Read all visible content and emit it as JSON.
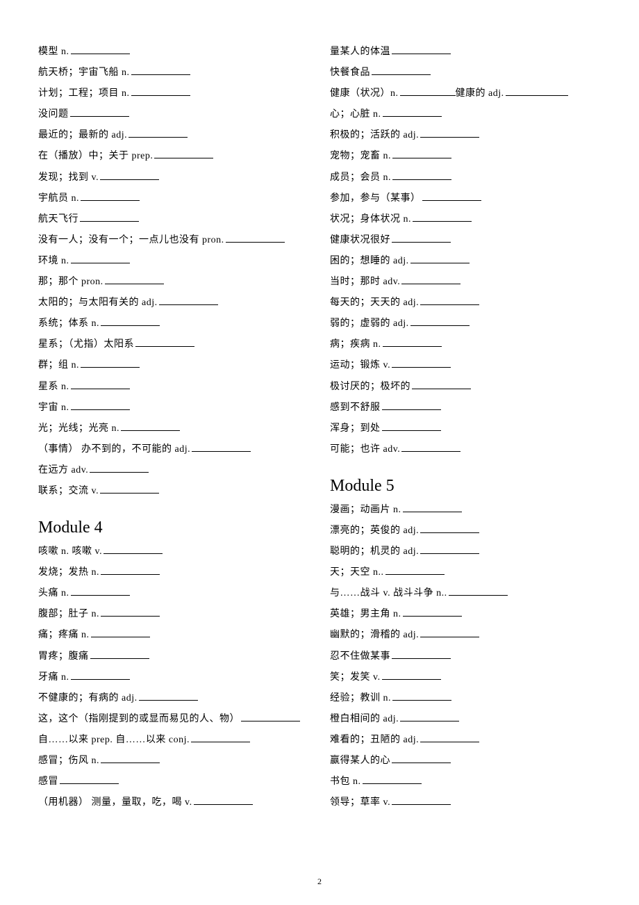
{
  "pageNumber": "2",
  "leftCol": {
    "section1": [
      "模型 n.",
      "航天桥；宇宙飞船 n.",
      "计划；工程；项目 n.",
      "没问题",
      "最近的；最新的 adj.",
      "在（播放）中；关于 prep.",
      "发现；找到 v.",
      "宇航员 n.",
      "航天飞行",
      "没有一人；没有一个；一点儿也没有 pron.",
      "环境 n.",
      "那；那个 pron.",
      "太阳的；与太阳有关的 adj.",
      "系统；体系 n.",
      "星系；（尤指）太阳系",
      "群；组 n.",
      "星系 n.",
      "宇宙 n.",
      "光；光线；光亮 n.",
      "（事情） 办不到的，不可能的 adj.",
      "在远方 adv.",
      "联系；交流 v."
    ],
    "module4": {
      "heading": "Module 4",
      "items": [
        "咳嗽 n. 咳嗽 v.",
        "发烧；发热 n.",
        "头痛 n.",
        "腹部；肚子 n.",
        "痛；疼痛 n.",
        "胃疼；腹痛",
        "牙痛 n.",
        "不健康的；有病的 adj.",
        "这，这个（指刚提到的或显而易见的人、物）",
        "自……以来 prep. 自……以来 conj.",
        "感冒；伤风 n.",
        "感冒",
        "（用机器） 测量，量取，吃，喝 v."
      ]
    }
  },
  "rightCol": {
    "section1": [
      "量某人的体温",
      "快餐食品",
      {
        "text": "健康（状况）n.",
        "extra": "健康的 adj."
      },
      "心；心脏 n.",
      "积极的；活跃的 adj.",
      "宠物；宠畜 n.",
      "成员；会员 n.",
      "参加，参与（某事）",
      "状况；身体状况 n.",
      "健康状况很好",
      "困的；想睡的 adj.",
      "当时；那时 adv.",
      "每天的；天天的 adj.",
      "弱的；虚弱的 adj.",
      "病；疾病 n.",
      "运动；锻炼 v.",
      "极讨厌的；极坏的",
      "感到不舒服",
      "浑身；到处",
      "可能；也许 adv."
    ],
    "module5": {
      "heading": "Module 5",
      "items": [
        "漫画；动画片 n.",
        "漂亮的；英俊的 adj.",
        "聪明的；机灵的 adj.",
        "天；天空 n..",
        "与……战斗 v.   战斗斗争 n..",
        "英雄；男主角 n.",
        "幽默的；滑稽的 adj.",
        "忍不住做某事",
        "笑；发笑 v.",
        "经验；教训 n.",
        "橙白相间的 adj.",
        "难看的；丑陋的 adj.",
        "赢得某人的心",
        "书包 n.",
        "领导；草率 v."
      ]
    }
  }
}
